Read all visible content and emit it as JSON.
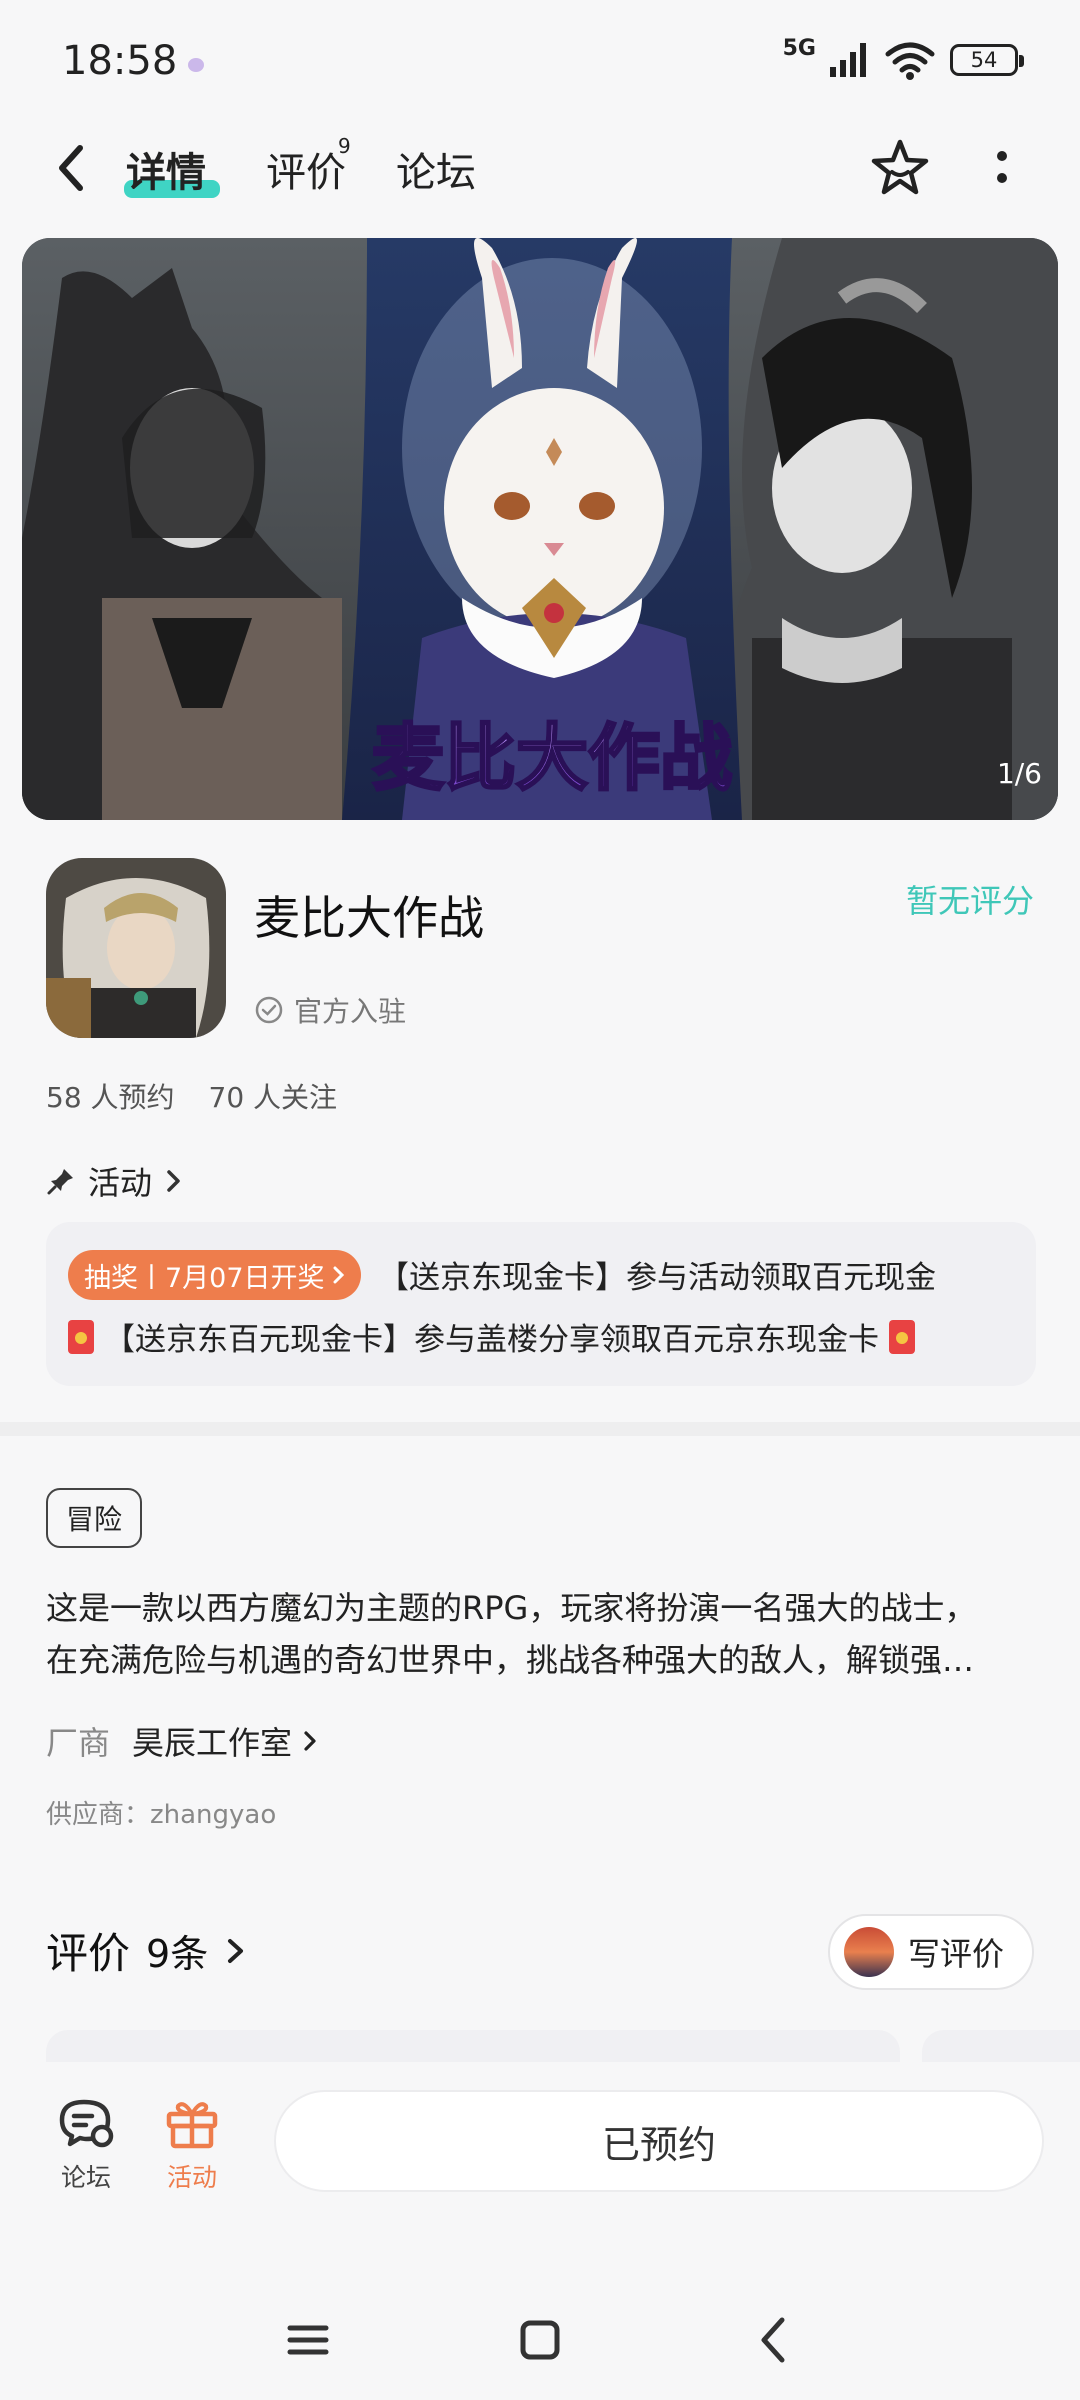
{
  "status_bar": {
    "time": "18:58",
    "network": "5G",
    "battery": "54"
  },
  "nav": {
    "tabs": [
      {
        "label": "详情",
        "active": true
      },
      {
        "label": "评价",
        "badge": "9"
      },
      {
        "label": "论坛"
      }
    ]
  },
  "banner": {
    "logo_text": "麦比大作战",
    "page_indicator": "1/6"
  },
  "game": {
    "title": "麦比大作战",
    "rating": "暂无评分",
    "official": "官方入驻",
    "reservations": "58 人预约",
    "followers": "70 人关注"
  },
  "activity": {
    "heading": "活动",
    "tag": "抽奖丨7月07日开奖",
    "line1": "【送京东现金卡】参与活动领取百元现金",
    "line2": "【送京东百元现金卡】参与盖楼分享领取百元京东现金卡"
  },
  "details": {
    "genre_tag": "冒险",
    "description_line1": "这是一款以西方魔幻为主题的RPG，玩家将扮演一名强大的战士，",
    "description_line2": "在充满危险与机遇的奇幻世界中，挑战各种强大的敌人，解锁强…",
    "vendor_label": "厂商",
    "vendor_name": "昊辰工作室",
    "supplier": "供应商：zhangyao"
  },
  "reviews": {
    "title": "评价",
    "count": "9条",
    "write_label": "写评价"
  },
  "bottom_bar": {
    "forum_label": "论坛",
    "activity_label": "活动",
    "reserve_label": "已预约"
  },
  "colors": {
    "accent_teal": "#3fc7b8",
    "accent_orange": "#ee7d4c"
  }
}
